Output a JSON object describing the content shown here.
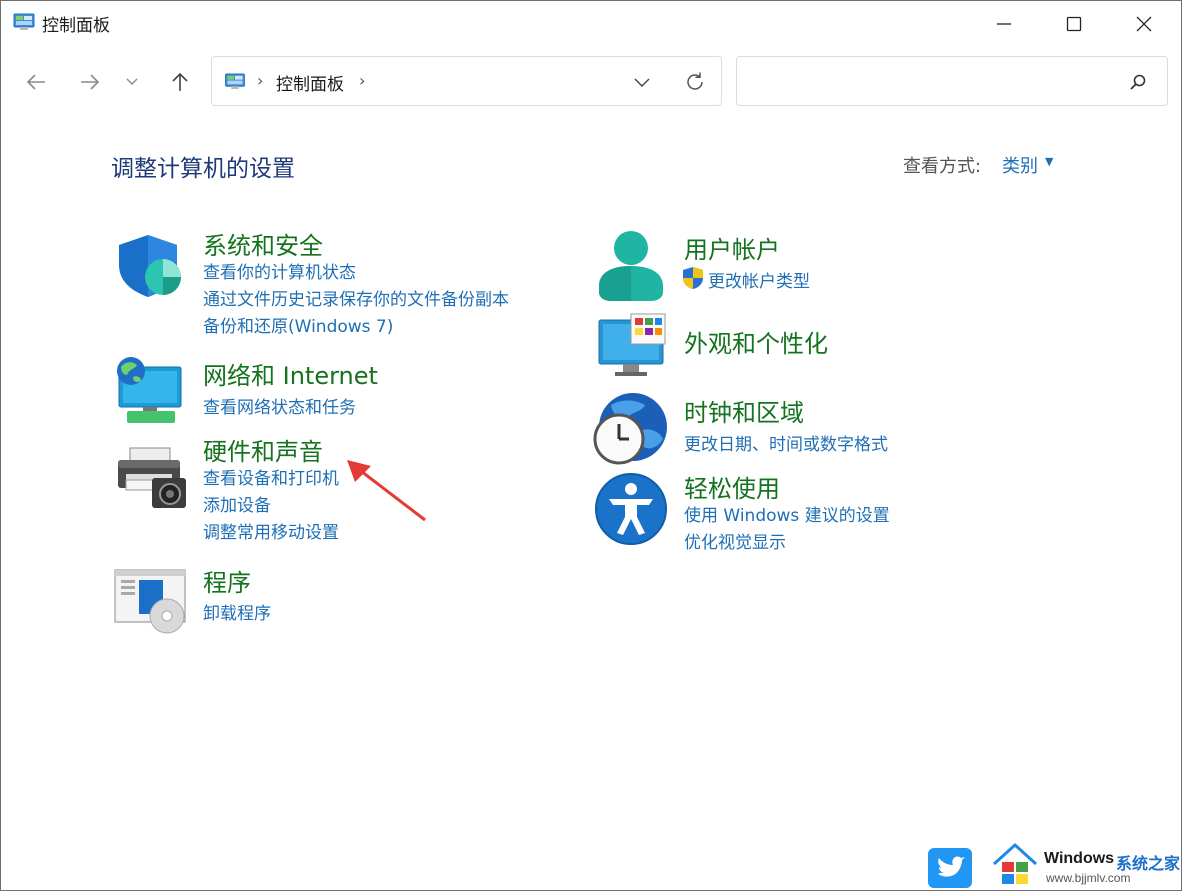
{
  "window": {
    "title": "控制面板"
  },
  "address": {
    "crumb": "控制面板",
    "separator": "›"
  },
  "search": {
    "placeholder": ""
  },
  "heading": "调整计算机的设置",
  "view_by": {
    "label": "查看方式:",
    "value": "类别"
  },
  "categories": {
    "system_security": {
      "title": "系统和安全",
      "links": [
        "查看你的计算机状态",
        "通过文件历史记录保存你的文件备份副本",
        "备份和还原(Windows 7)"
      ]
    },
    "network": {
      "title": "网络和 Internet",
      "links": [
        "查看网络状态和任务"
      ]
    },
    "hardware": {
      "title": "硬件和声音",
      "links": [
        "查看设备和打印机",
        "添加设备",
        "调整常用移动设置"
      ]
    },
    "programs": {
      "title": "程序",
      "links": [
        "卸载程序"
      ]
    },
    "user_accounts": {
      "title": "用户帐户",
      "links": [
        "更改帐户类型"
      ]
    },
    "appearance": {
      "title": "外观和个性化",
      "links": []
    },
    "clock_region": {
      "title": "时钟和区域",
      "links": [
        "更改日期、时间或数字格式"
      ]
    },
    "ease_of_access": {
      "title": "轻松使用",
      "links": [
        "使用 Windows 建议的设置",
        "优化视觉显示"
      ]
    }
  },
  "watermark": {
    "brand": "Windows",
    "suffix": "系统之家",
    "url": "www.bjjmlv.com"
  },
  "colors": {
    "title_green": "#15721e",
    "link_blue": "#1f6fb5",
    "heading_blue": "#1e3a78",
    "arrow_red": "#e53935"
  }
}
